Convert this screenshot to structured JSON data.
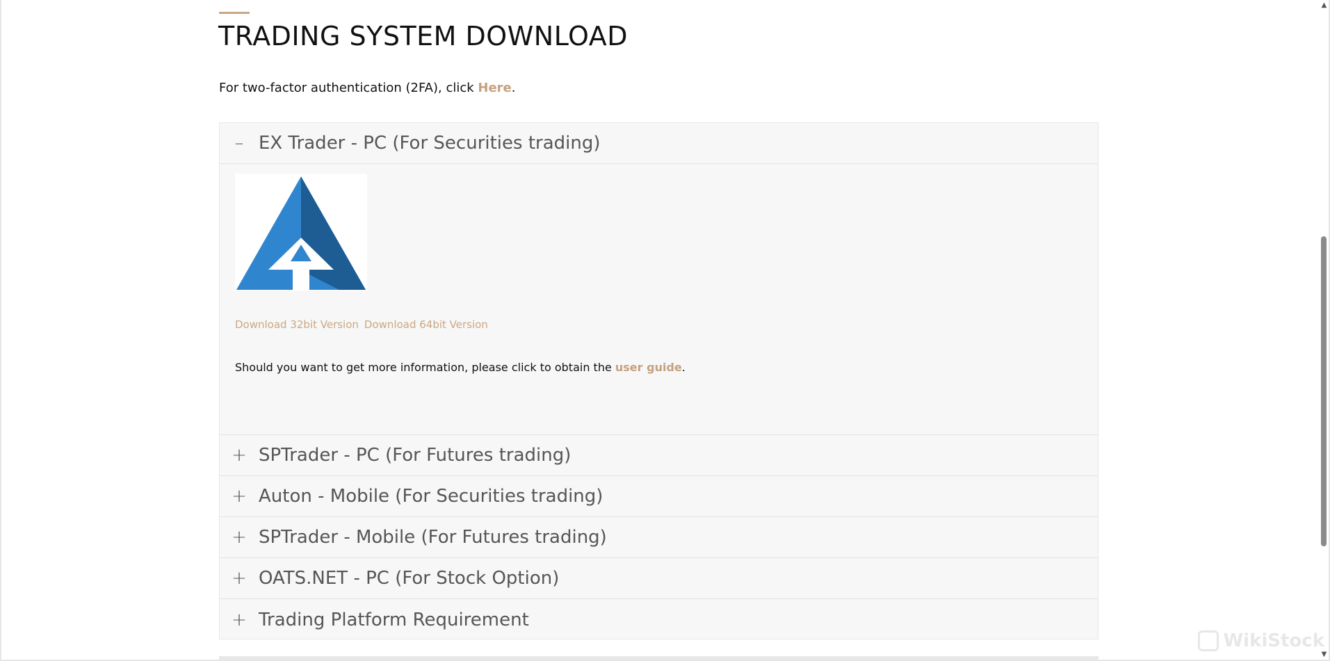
{
  "page": {
    "title": "TRADING SYSTEM DOWNLOAD",
    "intro_prefix": "For two-factor authentication (2FA), click ",
    "intro_link": "Here",
    "intro_suffix": "."
  },
  "accordion": {
    "items": [
      {
        "sign": "–",
        "title": "EX Trader - PC (For Securities trading)",
        "expanded": true,
        "downloads": [
          "Download 32bit Version",
          "Download 64bit Version"
        ],
        "info_prefix": "Should you want to get more information, please click to obtain the ",
        "info_link": "user guide",
        "info_suffix": "."
      },
      {
        "sign": "+",
        "title": "SPTrader - PC (For Futures trading)",
        "expanded": false
      },
      {
        "sign": "+",
        "title": "Auton - Mobile (For Securities trading)",
        "expanded": false
      },
      {
        "sign": "+",
        "title": "SPTrader - Mobile (For Futures trading)",
        "expanded": false
      },
      {
        "sign": "+",
        "title": "OATS.NET - PC (For Stock Option)",
        "expanded": false
      },
      {
        "sign": "+",
        "title": "Trading Platform Requirement",
        "expanded": false
      }
    ]
  },
  "colors": {
    "accent": "#c9a784",
    "logo_light_blue": "#2f86cf",
    "logo_dark_blue": "#1e5c94"
  },
  "icons": {
    "app_logo": "ex-trader-logo-icon",
    "scroll_up": "triangle-up-icon",
    "scroll_down": "triangle-down-icon",
    "watermark": "wikistock-logo-icon"
  },
  "watermark": {
    "text": "WikiStock"
  }
}
